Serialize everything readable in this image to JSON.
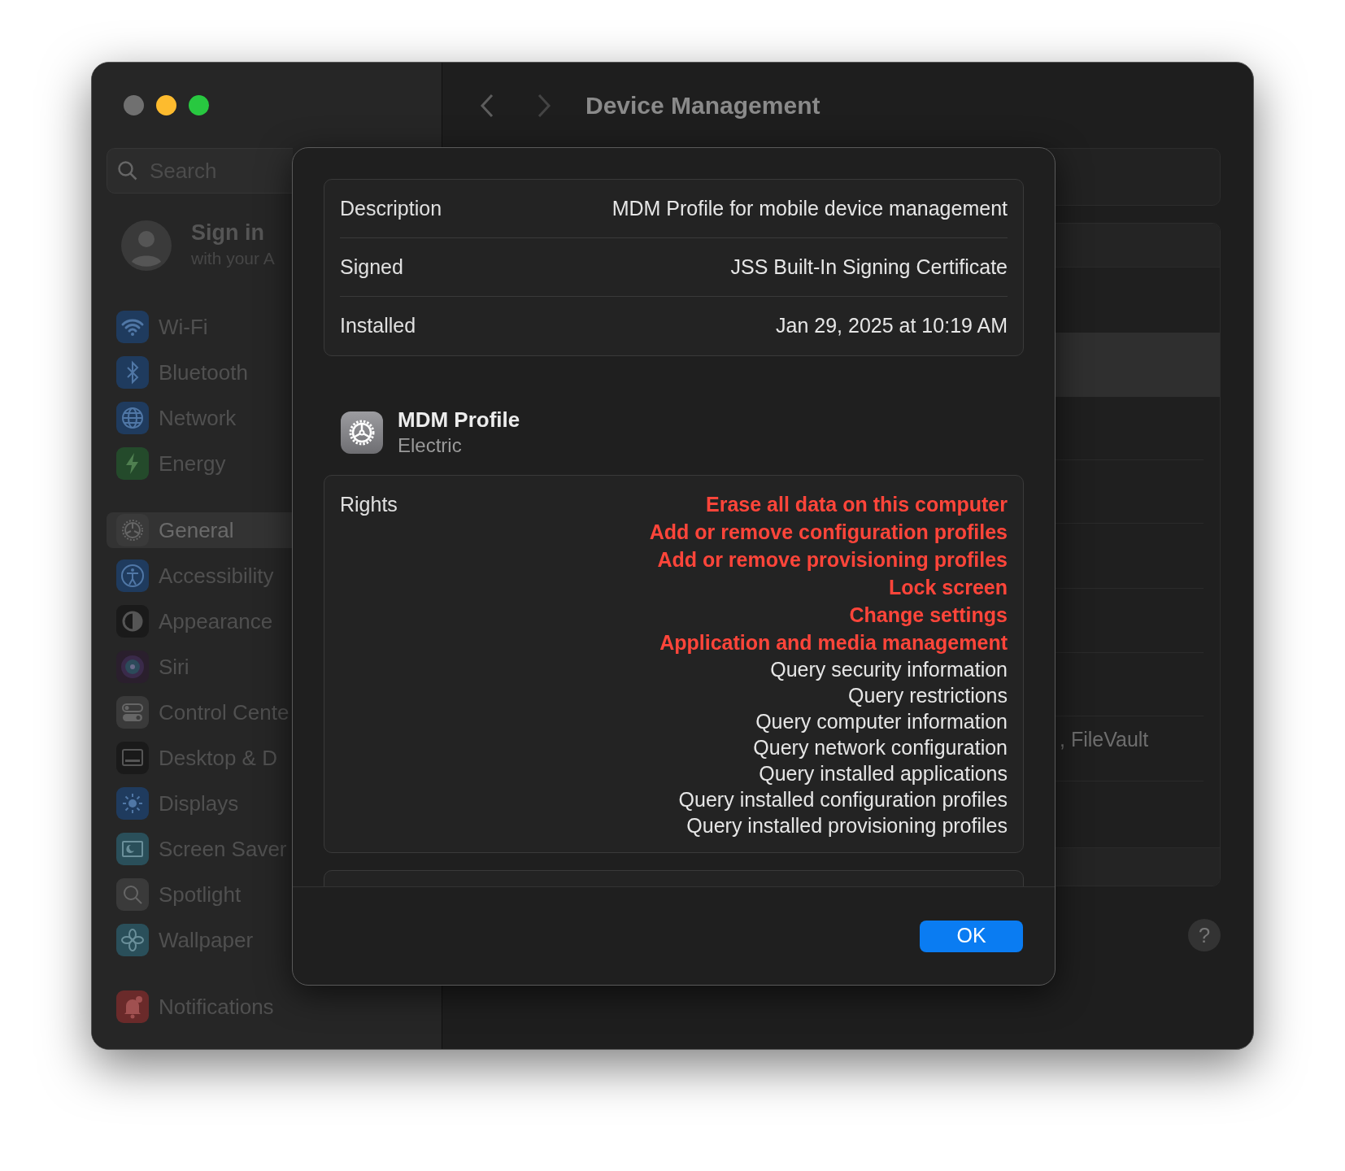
{
  "sidebar": {
    "search": {
      "placeholder": "Search"
    },
    "account": {
      "title": "Sign in",
      "subtitle": "with your A"
    },
    "groups": [
      [
        {
          "label": "Wi-Fi",
          "selected": false
        },
        {
          "label": "Bluetooth",
          "selected": false
        },
        {
          "label": "Network",
          "selected": false
        },
        {
          "label": "Energy",
          "selected": false
        }
      ],
      [
        {
          "label": "General",
          "selected": true
        },
        {
          "label": "Accessibility",
          "selected": false
        },
        {
          "label": "Appearance",
          "selected": false
        },
        {
          "label": "Siri",
          "selected": false
        },
        {
          "label": "Control Cente",
          "selected": false
        },
        {
          "label": "Desktop & D",
          "selected": false
        },
        {
          "label": "Displays",
          "selected": false
        },
        {
          "label": "Screen Saver",
          "selected": false
        },
        {
          "label": "Spotlight",
          "selected": false
        },
        {
          "label": "Wallpaper",
          "selected": false
        }
      ],
      [
        {
          "label": "Notifications",
          "selected": false
        }
      ]
    ]
  },
  "header": {
    "title": "Device Management"
  },
  "background_panel": {
    "row_text": ", FileVault",
    "help": "?"
  },
  "dialog": {
    "info": [
      {
        "label": "Description",
        "value": "MDM Profile for mobile device management"
      },
      {
        "label": "Signed",
        "value": "JSS Built-In Signing Certificate"
      },
      {
        "label": "Installed",
        "value": "Jan 29, 2025 at 10:19 AM"
      }
    ],
    "profile": {
      "name": "MDM Profile",
      "organization": "Electric"
    },
    "rights": {
      "label": "Rights",
      "items": [
        {
          "text": "Erase all data on this computer",
          "warning": true
        },
        {
          "text": "Add or remove configuration profiles",
          "warning": true
        },
        {
          "text": "Add or remove provisioning profiles",
          "warning": true
        },
        {
          "text": "Lock screen",
          "warning": true
        },
        {
          "text": "Change settings",
          "warning": true
        },
        {
          "text": "Application and media management",
          "warning": true
        },
        {
          "text": "Query security information",
          "warning": false
        },
        {
          "text": "Query restrictions",
          "warning": false
        },
        {
          "text": "Query computer information",
          "warning": false
        },
        {
          "text": "Query network configuration",
          "warning": false
        },
        {
          "text": "Query installed applications",
          "warning": false
        },
        {
          "text": "Query installed configuration profiles",
          "warning": false
        },
        {
          "text": "Query installed provisioning profiles",
          "warning": false
        }
      ]
    },
    "ok_button": "OK"
  }
}
